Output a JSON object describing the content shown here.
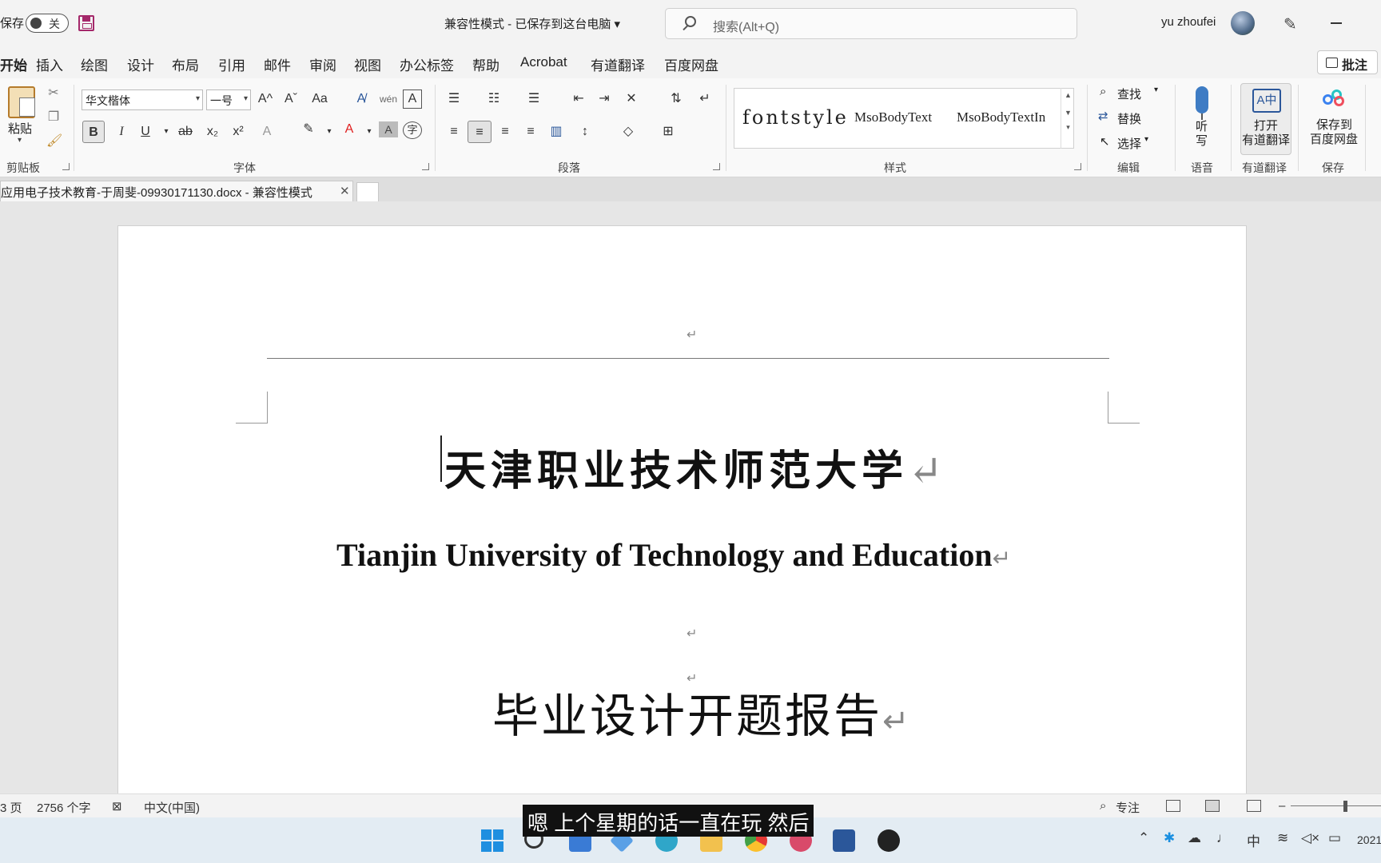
{
  "titlebar": {
    "autosave_label": "保存",
    "toggle_state": "关",
    "doc_status": "兼容性模式 - 已保存到这台电脑 ▾",
    "search_placeholder": "搜索(Alt+Q)",
    "username": "yu zhoufei"
  },
  "menu": {
    "tabs": [
      "开始",
      "插入",
      "绘图",
      "设计",
      "布局",
      "引用",
      "邮件",
      "审阅",
      "视图",
      "办公标签",
      "帮助",
      "Acrobat",
      "有道翻译",
      "百度网盘"
    ],
    "active_tab": "开始",
    "comment_button": "批注"
  },
  "ribbon": {
    "clipboard": {
      "paste_label": "粘贴",
      "group_label": "剪贴板"
    },
    "font": {
      "font_name": "华文楷体",
      "font_size": "一号",
      "grow": "A^",
      "shrink": "Aˇ",
      "case": "Aa",
      "bold": "B",
      "italic": "I",
      "underline": "U",
      "strike": "ab",
      "subscript": "x₂",
      "superscript": "x²",
      "group_label": "字体"
    },
    "paragraph": {
      "group_label": "段落"
    },
    "styles": {
      "items": [
        "fontstyle",
        "MsoBodyText",
        "MsoBodyTextIn"
      ],
      "group_label": "样式"
    },
    "editing": {
      "find": "查找",
      "replace": "替换",
      "select": "选择",
      "group_label": "编辑"
    },
    "voice": {
      "dictate_line1": "听",
      "dictate_line2": "写",
      "group_label": "语音"
    },
    "youdao": {
      "open_line1": "打开",
      "open_line2": "有道翻译",
      "group_label": "有道翻译"
    },
    "baidu": {
      "save_line1": "保存到",
      "save_line2": "百度网盘",
      "group_label": "保存"
    }
  },
  "document": {
    "tab_title": "应用电子技术教育-于周斐-09930171130.docx  -  兼容性模式",
    "return_mark": "↵",
    "title_cn": "天津职业技术师范大学",
    "title_en": "Tianjin University of Technology and Education",
    "report_title": "毕业设计开题报告"
  },
  "statusbar": {
    "page": "3 页",
    "word_count": "2756 个字",
    "language": "中文(中国)",
    "focus": "专注"
  },
  "taskbar": {
    "tray_ime": "中",
    "clock": "2021"
  },
  "subtitle": "嗯 上个星期的话一直在玩 然后",
  "colors": {
    "accent": "#2b579a",
    "highlight": "#ffeb00",
    "font_color": "#e02020",
    "save_icon": "#a4286a"
  }
}
